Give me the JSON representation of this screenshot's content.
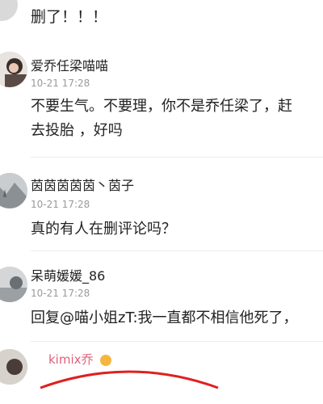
{
  "top_fragment": {
    "text": "删了！！！"
  },
  "comments": [
    {
      "username": "爱乔任梁喵喵",
      "time": "10-21 17:28",
      "content_lines": [
        "不要生气。不要理，你不是乔任梁了，赶",
        "去投胎 ，好吗"
      ]
    },
    {
      "username": "茵茵茵茵茵丶茵子",
      "time": "10-21 17:28",
      "content_lines": [
        "真的有人在删评论吗？"
      ]
    },
    {
      "username": "呆萌媛媛_86",
      "time": "10-21 17:28",
      "content_lines": [
        "回复@喵小姐zT:我一直都不相信他死了，"
      ]
    }
  ],
  "partial_bottom": {
    "username": "kimix乔"
  },
  "colors": {
    "text": "#222222",
    "timestamp": "#9a9a9a",
    "accent_username": "#e0607a",
    "annotation_circle": "#e02020"
  }
}
